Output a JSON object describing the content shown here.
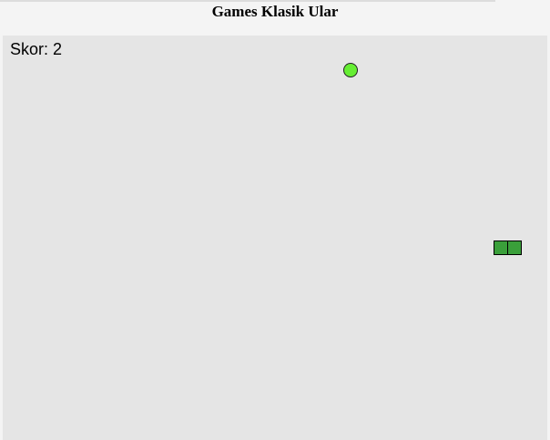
{
  "header": {
    "title": "Games Klasik Ular"
  },
  "game": {
    "score_text": "Skor: 2",
    "food_color": "#66ee33",
    "snake_color": "#3a9f3a",
    "board_color": "#e5e5e5",
    "snake_segments": 2
  }
}
